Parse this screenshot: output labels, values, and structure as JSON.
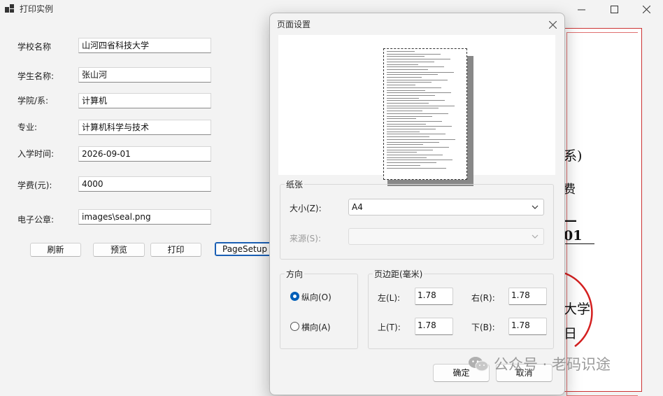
{
  "window": {
    "title": "打印实例"
  },
  "form": {
    "fields": [
      {
        "label": "学校名称",
        "value": "山河四省科技大学"
      },
      {
        "label": "学生名称:",
        "value": "张山河"
      },
      {
        "label": "学院/系:",
        "value": "计算机"
      },
      {
        "label": "专业:",
        "value": "计算机科学与技术"
      },
      {
        "label": "入学时间:",
        "value": "2026-09-01"
      },
      {
        "label": "学费(元):",
        "value": "4000"
      },
      {
        "label": "电子公章:",
        "value": "images\\seal.png"
      }
    ],
    "buttons": {
      "refresh": "刷新",
      "preview": "预览",
      "print": "打印",
      "pagesetup": "PageSetup"
    }
  },
  "preview": {
    "frag1": "系)",
    "frag2": "费",
    "frag3": "—01",
    "frag4": "大学",
    "frag5": "日"
  },
  "dialog": {
    "title": "页面设置",
    "paper": {
      "group": "纸张",
      "size_label": "大小(Z):",
      "size_value": "A4",
      "source_label": "来源(S):",
      "source_value": ""
    },
    "orientation": {
      "group": "方向",
      "portrait": "纵向(O)",
      "landscape": "横向(A)",
      "selected": "portrait"
    },
    "margins": {
      "group": "页边距(毫米)",
      "left_label": "左(L):",
      "left": "1.78",
      "right_label": "右(R):",
      "right": "1.78",
      "top_label": "上(T):",
      "top": "1.78",
      "bottom_label": "下(B):",
      "bottom": "1.78"
    },
    "ok": "确定",
    "cancel": "取消"
  },
  "watermark": {
    "text": "公众号 · 老码识途"
  },
  "colors": {
    "accent": "#005fb8",
    "seal_red": "#d42020"
  }
}
